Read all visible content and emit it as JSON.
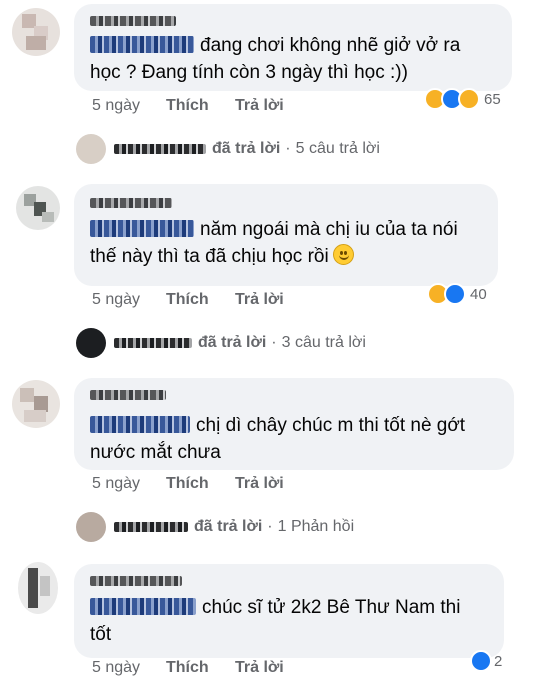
{
  "comments": [
    {
      "text": "đang chơi không nhẽ giở vở ra học ? Đang tính còn 3 ngày thì học :))",
      "line1": "đang chơi không nhẽ giở vở ra",
      "line2": "học ? Đang tính còn 3 ngày thì học :))",
      "time": "5 ngày",
      "like": "Thích",
      "reply": "Trả lời",
      "reactions": [
        "haha-icon",
        "like-icon",
        "sad-icon"
      ],
      "reaction_count": "65",
      "replies_summary": {
        "verb": "đã trả lời",
        "sep": "·",
        "count": "5 câu trả lời"
      }
    },
    {
      "line1": "năm ngoái mà chị iu của ta nói",
      "line2": "thế này thì ta đã chịu học rồi",
      "time": "5 ngày",
      "like": "Thích",
      "reply": "Trả lời",
      "reactions": [
        "haha-icon",
        "like-icon"
      ],
      "reaction_count": "40",
      "replies_summary": {
        "verb": "đã trả lời",
        "sep": "·",
        "count": "3 câu trả lời"
      }
    },
    {
      "line1": "chị dì chây chúc m thi tốt nè gớt",
      "line2": "nước mắt chưa",
      "time": "5 ngày",
      "like": "Thích",
      "reply": "Trả lời",
      "replies_summary": {
        "verb": "đã trả lời",
        "sep": "·",
        "count": "1 Phản hồi"
      }
    },
    {
      "line1": "chúc sĩ tử 2k2 Bê Thư Nam thi",
      "line2": "tốt",
      "time": "5 ngày",
      "like": "Thích",
      "reply": "Trả lời",
      "reactions": [
        "like-icon"
      ],
      "reaction_count": "2"
    }
  ],
  "colors": {
    "bubble": "#f0f2f5",
    "meta": "#65676b",
    "like_blue": "#1877f2",
    "haha_yellow": "#f7b125"
  }
}
